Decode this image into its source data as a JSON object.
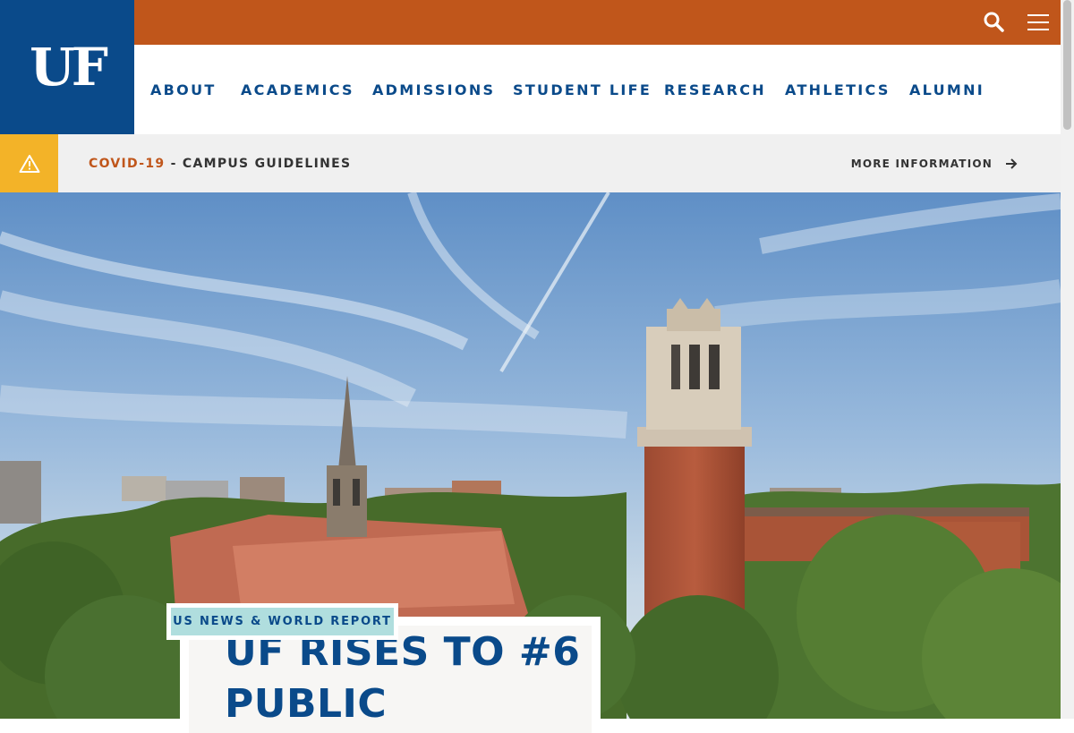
{
  "header": {
    "logo_text": "UF",
    "nav": [
      "ABOUT",
      "ACADEMICS",
      "ADMISSIONS",
      "STUDENT LIFE",
      "RESEARCH",
      "ATHLETICS",
      "ALUMNI"
    ]
  },
  "alert": {
    "covid": "COVID-19",
    "separator": " - ",
    "text": "CAMPUS GUIDELINES",
    "more": "MORE INFORMATION"
  },
  "hero": {
    "tag": "US NEWS & WORLD REPORT",
    "title": "UF RISES TO #6 PUBLIC"
  },
  "icons": [
    "search-icon",
    "menu-icon",
    "warning-icon",
    "arrow-right-icon"
  ],
  "colors": {
    "uf_blue": "#0a4a8a",
    "uf_orange": "#c0561b",
    "alert_yellow": "#f3b328",
    "tag_teal": "#b0dede"
  }
}
